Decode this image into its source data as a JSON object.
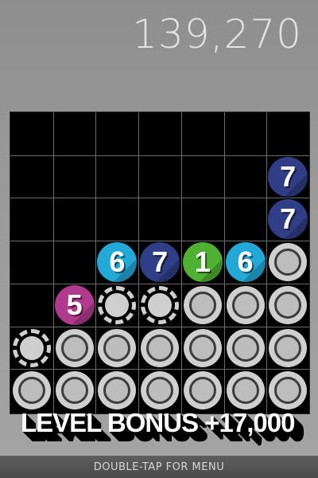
{
  "score": "139,270",
  "bonus_text": "LEVEL BONUS +17,000",
  "menu_hint": "DOUBLE-TAP FOR MENU",
  "colors": {
    "blue_7": "#2f3e86",
    "cyan_6": "#23a9d8",
    "green_1": "#4fb131",
    "magenta_5": "#b23a8e",
    "gray_disc": "#cfcfcf"
  },
  "board": {
    "columns": 7,
    "rows": 7,
    "cells": [
      {
        "row": 1,
        "col": 6,
        "kind": "number",
        "label": "7",
        "color": "blue_7"
      },
      {
        "row": 2,
        "col": 6,
        "kind": "number",
        "label": "7",
        "color": "blue_7"
      },
      {
        "row": 3,
        "col": 2,
        "kind": "number",
        "label": "6",
        "color": "cyan_6"
      },
      {
        "row": 3,
        "col": 3,
        "kind": "number",
        "label": "7",
        "color": "blue_7"
      },
      {
        "row": 3,
        "col": 4,
        "kind": "number",
        "label": "1",
        "color": "green_1"
      },
      {
        "row": 3,
        "col": 5,
        "kind": "number",
        "label": "6",
        "color": "cyan_6"
      },
      {
        "row": 3,
        "col": 6,
        "kind": "gray"
      },
      {
        "row": 4,
        "col": 1,
        "kind": "number",
        "label": "5",
        "color": "magenta_5"
      },
      {
        "row": 4,
        "col": 2,
        "kind": "cracked"
      },
      {
        "row": 4,
        "col": 3,
        "kind": "cracked"
      },
      {
        "row": 4,
        "col": 4,
        "kind": "gray"
      },
      {
        "row": 4,
        "col": 5,
        "kind": "gray"
      },
      {
        "row": 4,
        "col": 6,
        "kind": "gray"
      },
      {
        "row": 5,
        "col": 0,
        "kind": "cracked"
      },
      {
        "row": 5,
        "col": 1,
        "kind": "gray"
      },
      {
        "row": 5,
        "col": 2,
        "kind": "gray"
      },
      {
        "row": 5,
        "col": 3,
        "kind": "gray"
      },
      {
        "row": 5,
        "col": 4,
        "kind": "gray"
      },
      {
        "row": 5,
        "col": 5,
        "kind": "gray"
      },
      {
        "row": 5,
        "col": 6,
        "kind": "gray"
      },
      {
        "row": 6,
        "col": 0,
        "kind": "gray"
      },
      {
        "row": 6,
        "col": 1,
        "kind": "gray"
      },
      {
        "row": 6,
        "col": 2,
        "kind": "gray"
      },
      {
        "row": 6,
        "col": 3,
        "kind": "gray"
      },
      {
        "row": 6,
        "col": 4,
        "kind": "gray"
      },
      {
        "row": 6,
        "col": 5,
        "kind": "gray"
      },
      {
        "row": 6,
        "col": 6,
        "kind": "gray"
      }
    ]
  }
}
